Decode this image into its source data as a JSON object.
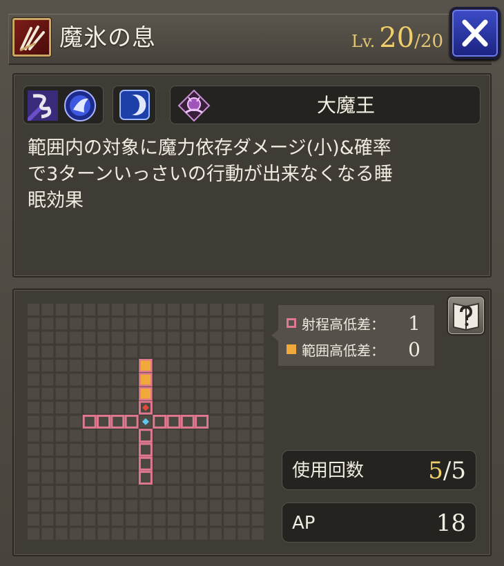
{
  "header": {
    "skill_icon": "claw-slash-icon",
    "title": "魔氷の息",
    "level_prefix": "Lv.",
    "level_current": "20",
    "level_separator": "/",
    "level_max": "20",
    "close_icon": "close-x-icon"
  },
  "skill_info": {
    "element_icons": [
      "wind-gust-icon",
      "ice-orb-icon",
      "moon-icon"
    ],
    "job_icon": "demon-lord-emblem-icon",
    "job_name": "大魔王",
    "description_lines": [
      "範囲内の対象に魔力依存ダメージ(小)&確率",
      "で3ターンいっさいの行動が出来なくなる睡",
      "眠効果"
    ]
  },
  "range": {
    "grid_columns": 17,
    "grid_rows": 17,
    "legend": [
      {
        "label": "射程高低差：",
        "value": "1",
        "color": "#e0788f"
      },
      {
        "label": "範囲高低差：",
        "value": "0",
        "color": "#f2a93b"
      }
    ],
    "help_icon": "help-book-icon"
  },
  "stats": {
    "uses_label": "使用回数",
    "uses_current": "5",
    "uses_separator": "/",
    "uses_max": "5",
    "ap_label": "AP",
    "ap_value": "18"
  },
  "colors": {
    "range_tile": "#e0788f",
    "area_tile": "#f2a93b",
    "caster_tile": "#5ec8f0",
    "close_button": "#2a36a8",
    "level_gold": "#f0cf6a"
  }
}
